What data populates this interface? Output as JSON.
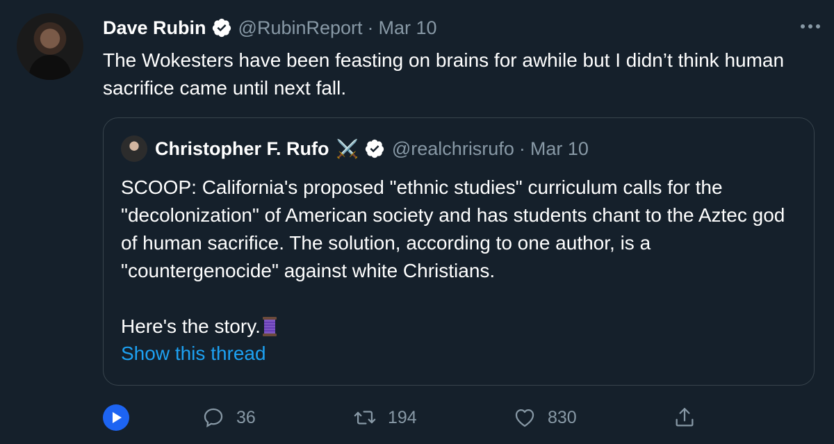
{
  "tweet": {
    "author_name": "Dave Rubin",
    "handle": "@RubinReport",
    "separator": "·",
    "date": "Mar 10",
    "text": "The Wokesters have been feasting on brains for awhile but I didn’t think human sacrifice came until next fall."
  },
  "quote": {
    "author_name": "Christopher F. Rufo",
    "name_emoji": "⚔️",
    "handle": "@realchrisrufo",
    "separator": "·",
    "date": "Mar 10",
    "text": "SCOOP: California's proposed \"ethnic studies\" curriculum calls for the \"decolonization\" of American society and has students chant to the Aztec god of human sacrifice. The solution, according to one author, is a \"countergenocide\" against white Christians.\n\nHere's the story.",
    "show_thread_label": "Show this thread"
  },
  "actions": {
    "replies": "36",
    "retweets": "194",
    "likes": "830"
  },
  "icons": {
    "more": "more-horizontal-icon",
    "verified": "verified-badge-icon",
    "play": "play-icon",
    "reply": "reply-icon",
    "retweet": "retweet-icon",
    "like": "heart-icon",
    "share": "share-icon",
    "thread": "spool-of-thread-emoji"
  },
  "colors": {
    "background": "#15202b",
    "secondary_text": "#8899a6",
    "accent": "#1da1f2",
    "border": "#38444d",
    "play_button": "#1d64f2"
  }
}
